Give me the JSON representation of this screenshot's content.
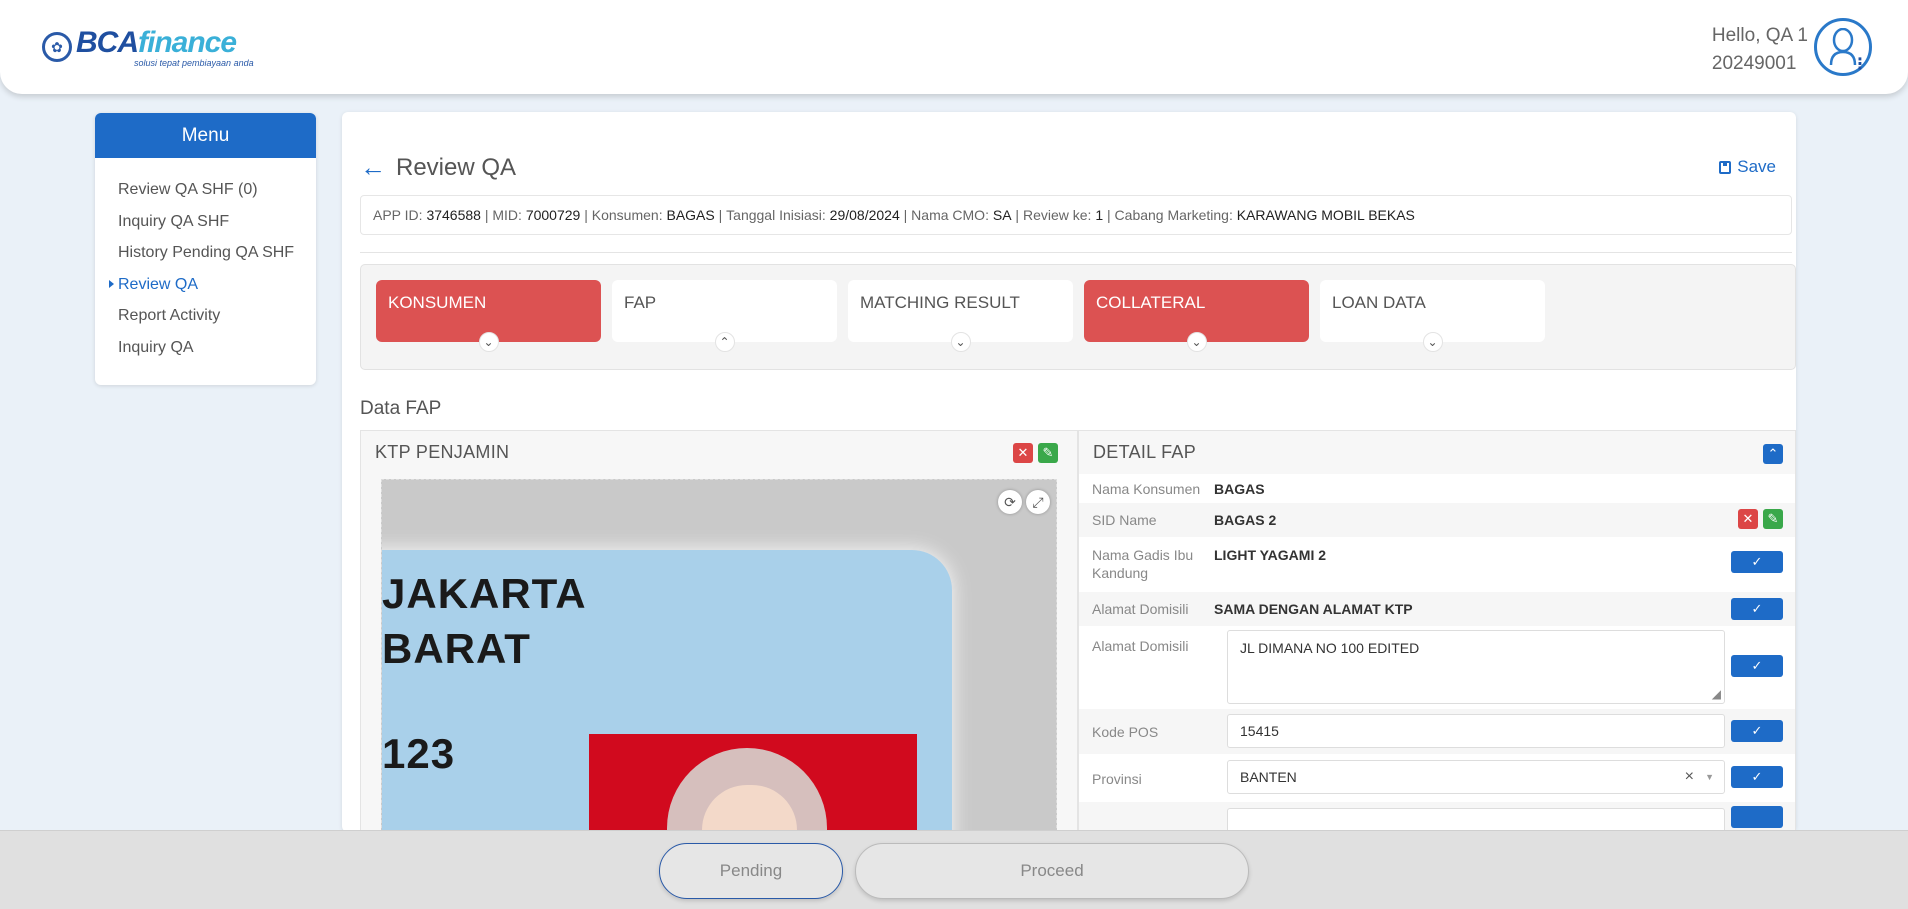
{
  "header": {
    "brand_name_main": "BCA",
    "brand_name_accent": "finance",
    "brand_tagline": "solusi tepat pembiayaan anda",
    "greeting": "Hello, QA 1",
    "user_id": "20249001"
  },
  "menu": {
    "title": "Menu",
    "items": [
      {
        "label": "Review QA SHF (0)"
      },
      {
        "label": "Inquiry QA SHF"
      },
      {
        "label": "History Pending QA SHF"
      },
      {
        "label": "Review QA"
      },
      {
        "label": "Report Activity"
      },
      {
        "label": "Inquiry QA"
      }
    ],
    "active_index": 3
  },
  "page": {
    "title": "Review QA",
    "save_label": "Save"
  },
  "info_bar": {
    "app_id_label": "APP ID:",
    "app_id": "3746588",
    "mid_label": "MID:",
    "mid": "7000729",
    "konsumen_label": "Konsumen:",
    "konsumen": "BAGAS",
    "tanggal_label": "Tanggal Inisiasi:",
    "tanggal": "29/08/2024",
    "cmo_label": "Nama CMO:",
    "cmo": "SA",
    "review_label": "Review ke:",
    "review": "1",
    "cabang_label": "Cabang Marketing:",
    "cabang": "KARAWANG MOBIL BEKAS"
  },
  "tabs": [
    {
      "label": "KONSUMEN",
      "state": "error"
    },
    {
      "label": "FAP",
      "state": "normal"
    },
    {
      "label": "MATCHING RESULT",
      "state": "normal"
    },
    {
      "label": "COLLATERAL",
      "state": "error"
    },
    {
      "label": "LOAN DATA",
      "state": "normal"
    }
  ],
  "section_label": "Data FAP",
  "ktp_panel": {
    "title": "KTP PENJAMIN",
    "image_text": {
      "line1": "JAKARTA",
      "line2": "BARAT",
      "line3": "123"
    }
  },
  "detail_panel": {
    "title": "DETAIL FAP",
    "rows": {
      "nama_konsumen": {
        "label": "Nama Konsumen",
        "value": "BAGAS"
      },
      "sid_name": {
        "label": "SID Name",
        "value": "BAGAS 2"
      },
      "nama_gadis": {
        "label": "Nama Gadis Ibu Kandung",
        "value": "LIGHT YAGAMI 2"
      },
      "alamat_domisili_1": {
        "label": "Alamat Domisili",
        "value": "SAMA DENGAN ALAMAT KTP"
      },
      "alamat_domisili_2": {
        "label": "Alamat Domisili",
        "value": "JL DIMANA NO 100 EDITED"
      },
      "kode_pos": {
        "label": "Kode POS",
        "value": "15415"
      },
      "provinsi": {
        "label": "Provinsi",
        "value": "BANTEN"
      }
    }
  },
  "footer": {
    "pending_label": "Pending",
    "proceed_label": "Proceed"
  },
  "colors": {
    "primary": "#1e6bc7",
    "error_tab": "#dc5252",
    "approve": "#3aa84a",
    "reject": "#dc4646"
  }
}
